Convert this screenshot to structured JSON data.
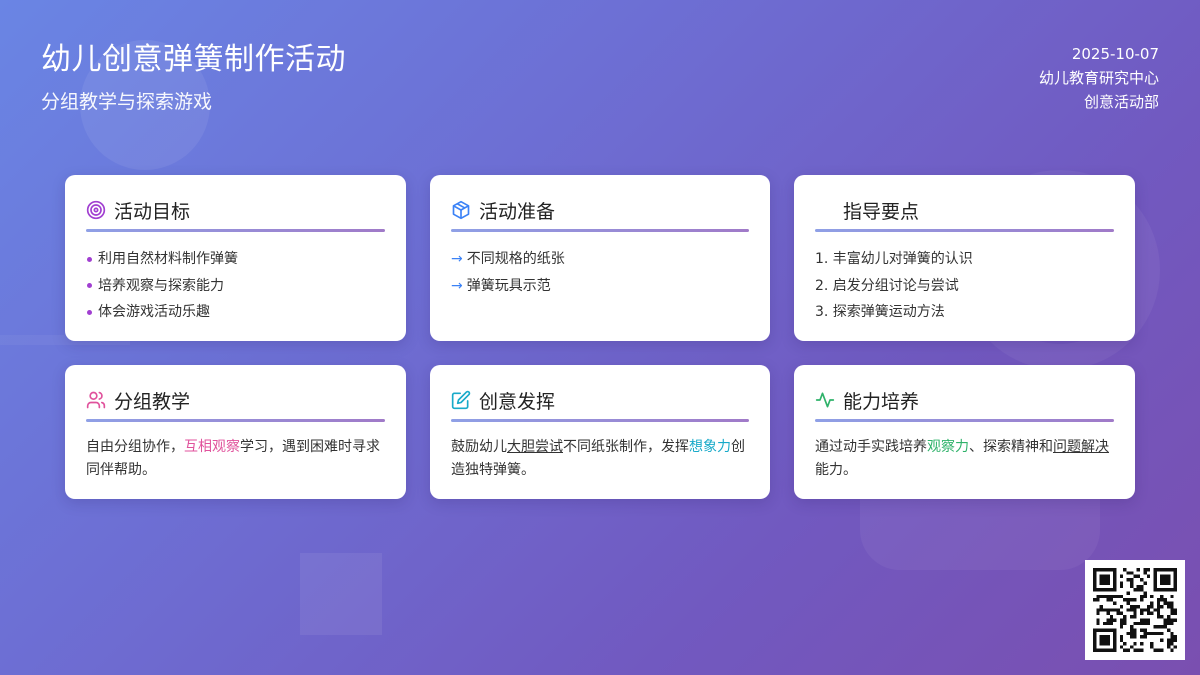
{
  "header": {
    "title": "幼儿创意弹簧制作活动",
    "subtitle": "分组教学与探索游戏"
  },
  "meta": {
    "date": "2025-10-07",
    "org": "幼儿教育研究中心",
    "dept": "创意活动部"
  },
  "colors": {
    "accent_purple": "#a13fd1",
    "accent_blue": "#3b82f6",
    "accent_pink": "#e0529c",
    "accent_teal": "#18aac9",
    "accent_green": "#2fb26a"
  },
  "cards": {
    "goals": {
      "icon": "target-icon",
      "title": "活动目标",
      "items": [
        "利用自然材料制作弹簧",
        "培养观察与探索能力",
        "体会游戏活动乐趣"
      ]
    },
    "prep": {
      "icon": "box-icon",
      "title": "活动准备",
      "items": [
        "不同规格的纸张",
        "弹簧玩具示范"
      ]
    },
    "guide": {
      "title": "指导要点",
      "items": [
        "1. 丰富幼儿对弹簧的认识",
        "2. 启发分组讨论与尝试",
        "3. 探索弹簧运动方法"
      ]
    },
    "group": {
      "icon": "users-icon",
      "title": "分组教学",
      "text_a": "自由分组协作，",
      "text_b": "互相观察",
      "text_c": "学习，遇到困难时寻求同伴帮助。"
    },
    "creative": {
      "icon": "edit-icon",
      "title": "创意发挥",
      "text_a": "鼓励幼儿",
      "text_b": "大胆尝试",
      "text_c": "不同纸张制作，发挥",
      "text_d": "想象力",
      "text_e": "创造独特弹簧。"
    },
    "ability": {
      "icon": "activity-icon",
      "title": "能力培养",
      "text_a": "通过动手实践培养",
      "text_b": "观察力",
      "text_c": "、探索精神和",
      "text_d": "问题解决",
      "text_e": "能力。"
    }
  },
  "qr": {
    "icon": "qr-code-icon"
  }
}
